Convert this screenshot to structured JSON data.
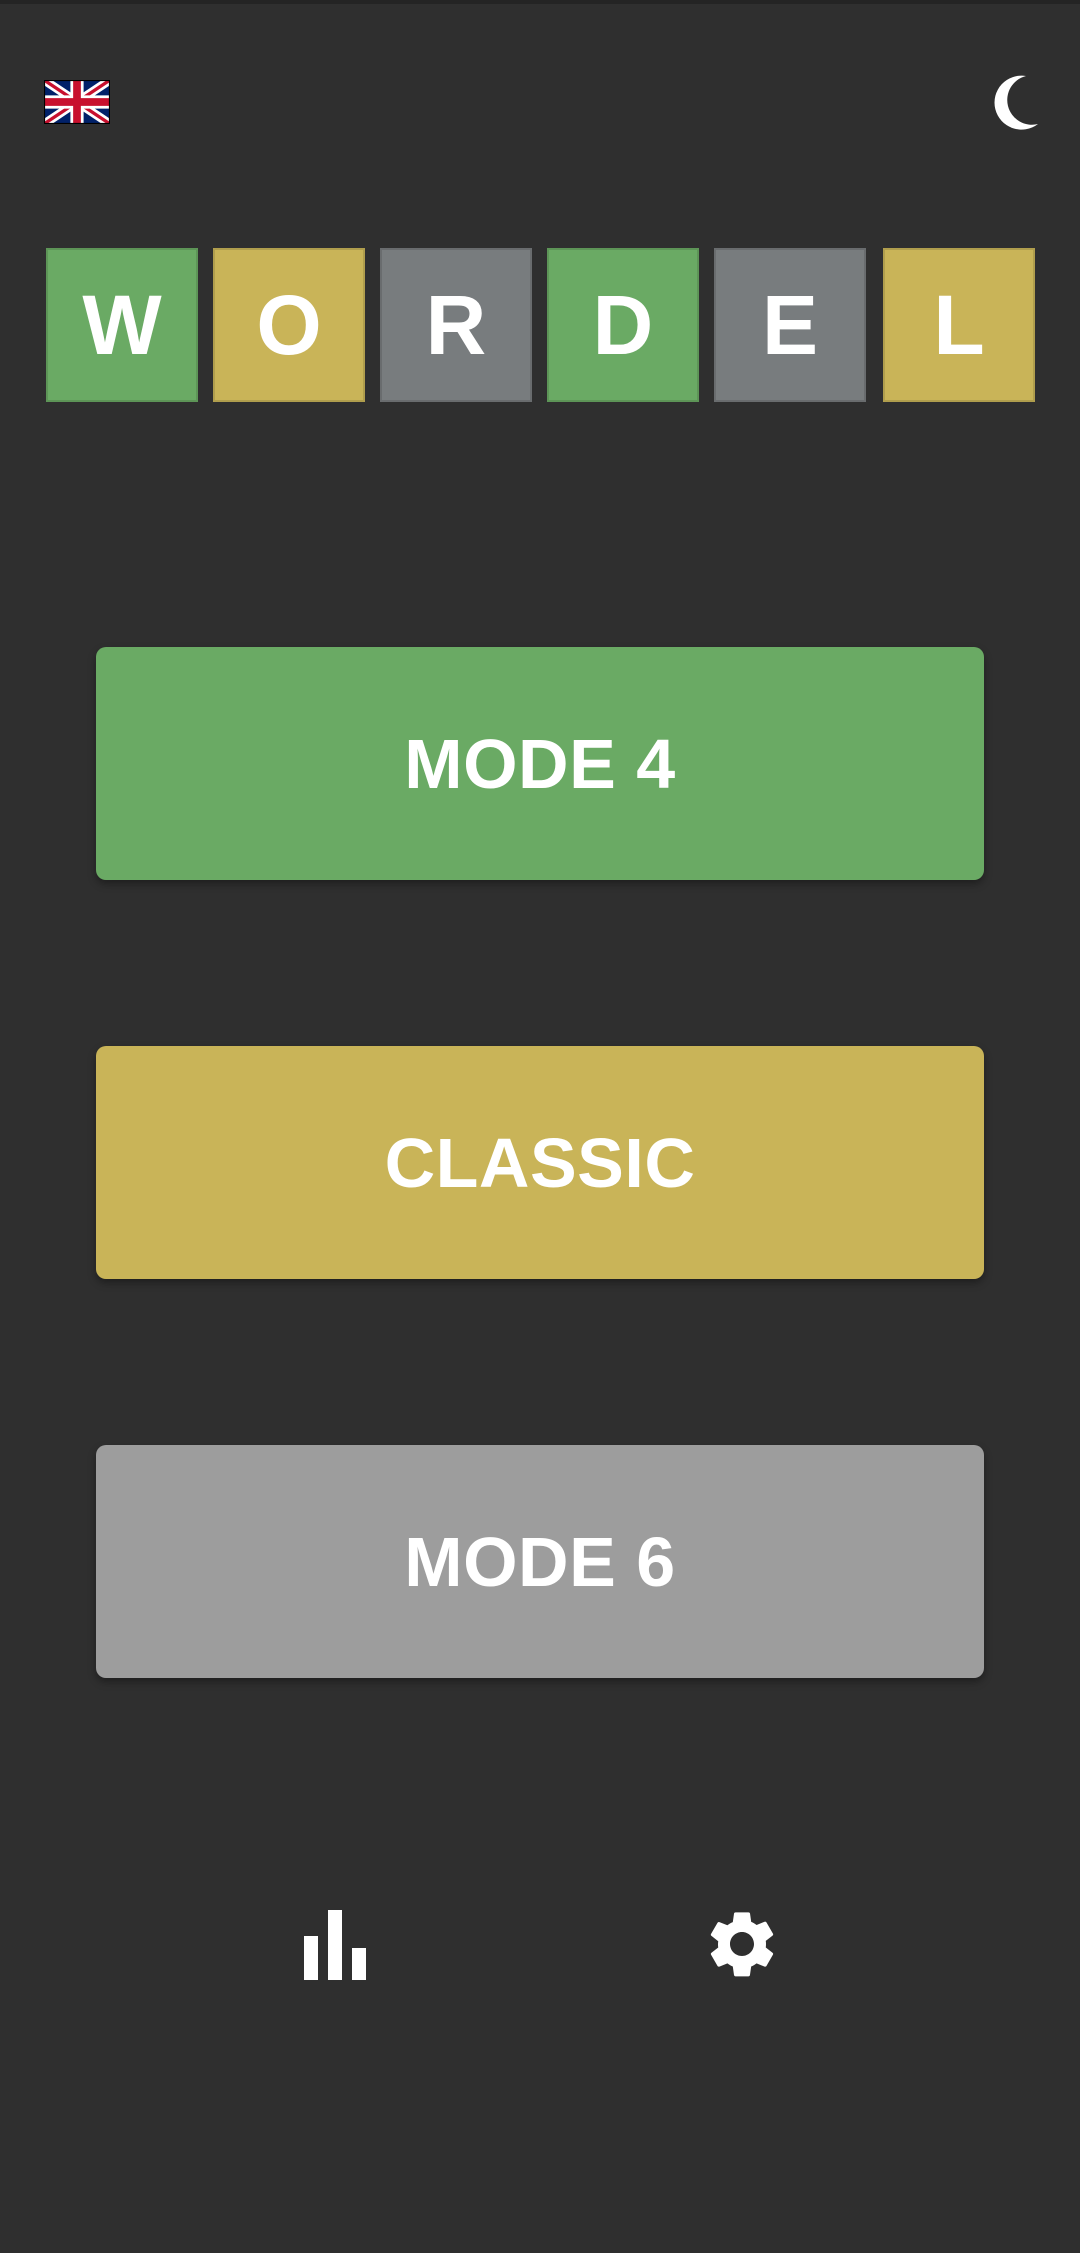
{
  "header": {
    "language_icon": "uk-flag-icon",
    "theme_icon": "moon-icon"
  },
  "title": {
    "tiles": [
      {
        "letter": "W",
        "color": "#6aaa64"
      },
      {
        "letter": "O",
        "color": "#c9b458"
      },
      {
        "letter": "R",
        "color": "#787c7e"
      },
      {
        "letter": "D",
        "color": "#6aaa64"
      },
      {
        "letter": "E",
        "color": "#787c7e"
      },
      {
        "letter": "L",
        "color": "#c9b458"
      }
    ]
  },
  "modes": [
    {
      "label": "MODE 4",
      "color": "#6aaa64"
    },
    {
      "label": "CLASSIC",
      "color": "#c9b458"
    },
    {
      "label": "MODE 6",
      "color": "#9d9d9d"
    }
  ],
  "footer": {
    "stats_icon": "bar-chart-icon",
    "settings_icon": "gear-icon"
  },
  "colors": {
    "background": "#2f2f2f",
    "green": "#6aaa64",
    "yellow": "#c9b458",
    "gray": "#787c7e",
    "light_gray": "#9d9d9d",
    "text": "#ffffff"
  }
}
